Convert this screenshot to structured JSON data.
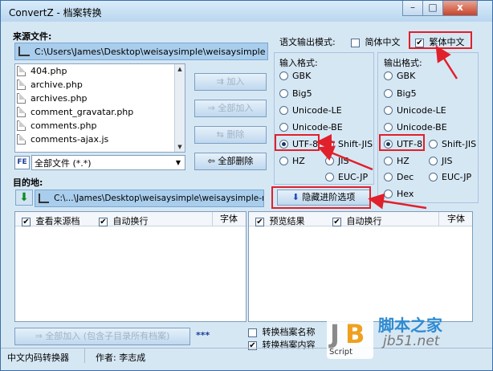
{
  "window": {
    "title": "ConvertZ - 档案转换",
    "minimize": "–",
    "maximize": "□",
    "close": "x"
  },
  "source": {
    "label": "来源文件:",
    "path": "C:\\Users\\James\\Desktop\\weisaysimple\\weisaysimple",
    "files": [
      "404.php",
      "archive.php",
      "archives.php",
      "comment_gravatar.php",
      "comments.php",
      "comments-ajax.js"
    ],
    "filter_icon_label": "FE",
    "filter_value": "全部文件 (*.*)"
  },
  "buttons": {
    "add": "加入",
    "add_all": "全部加入",
    "remove": "删除",
    "remove_all": "全部删除"
  },
  "destination": {
    "label": "目的地:",
    "path": "C:\\...\\James\\Desktop\\weisaysimple\\weisaysimple-new"
  },
  "language": {
    "label": "语文输出模式:",
    "simplified": "简体中文",
    "traditional": "繁体中文",
    "traditional_checked": "✔"
  },
  "input_format": {
    "title": "输入格式:",
    "options": [
      "GBK",
      "Big5",
      "Unicode-LE",
      "Unicode-BE",
      "UTF-8",
      "Shift-JIS",
      "HZ",
      "JIS",
      "EUC-JP"
    ],
    "selected": "UTF-8"
  },
  "output_format": {
    "title": "输出格式:",
    "options": [
      "GBK",
      "Big5",
      "Unicode-LE",
      "Unicode-BE",
      "UTF-8",
      "Shift-JIS",
      "HZ",
      "JIS",
      "Dec",
      "EUC-JP",
      "Hex"
    ],
    "selected": "UTF-8"
  },
  "advanced_button": "隐藏进阶选项",
  "left_panel": {
    "view_source": "查看来源档",
    "wrap": "自动换行",
    "font": "字体"
  },
  "right_panel": {
    "preview": "预览结果",
    "wrap": "自动换行",
    "font": "字体"
  },
  "bottom": {
    "add_all_sub": "全部加入 (包含子目录所有档案)",
    "stars": "***",
    "convert_name": "转换档案名称",
    "convert_content": "转换档案内容"
  },
  "status": {
    "app_name": "中文内码转换器",
    "author": "作者: 李志成"
  },
  "watermark": {
    "script": "Script",
    "site_cn": "脚本之家",
    "site_url": "jb51.net"
  },
  "colors": {
    "highlight_red": "#e0202a",
    "title_bar": "#c6dff3",
    "window_bg": "#d6e7f4"
  }
}
